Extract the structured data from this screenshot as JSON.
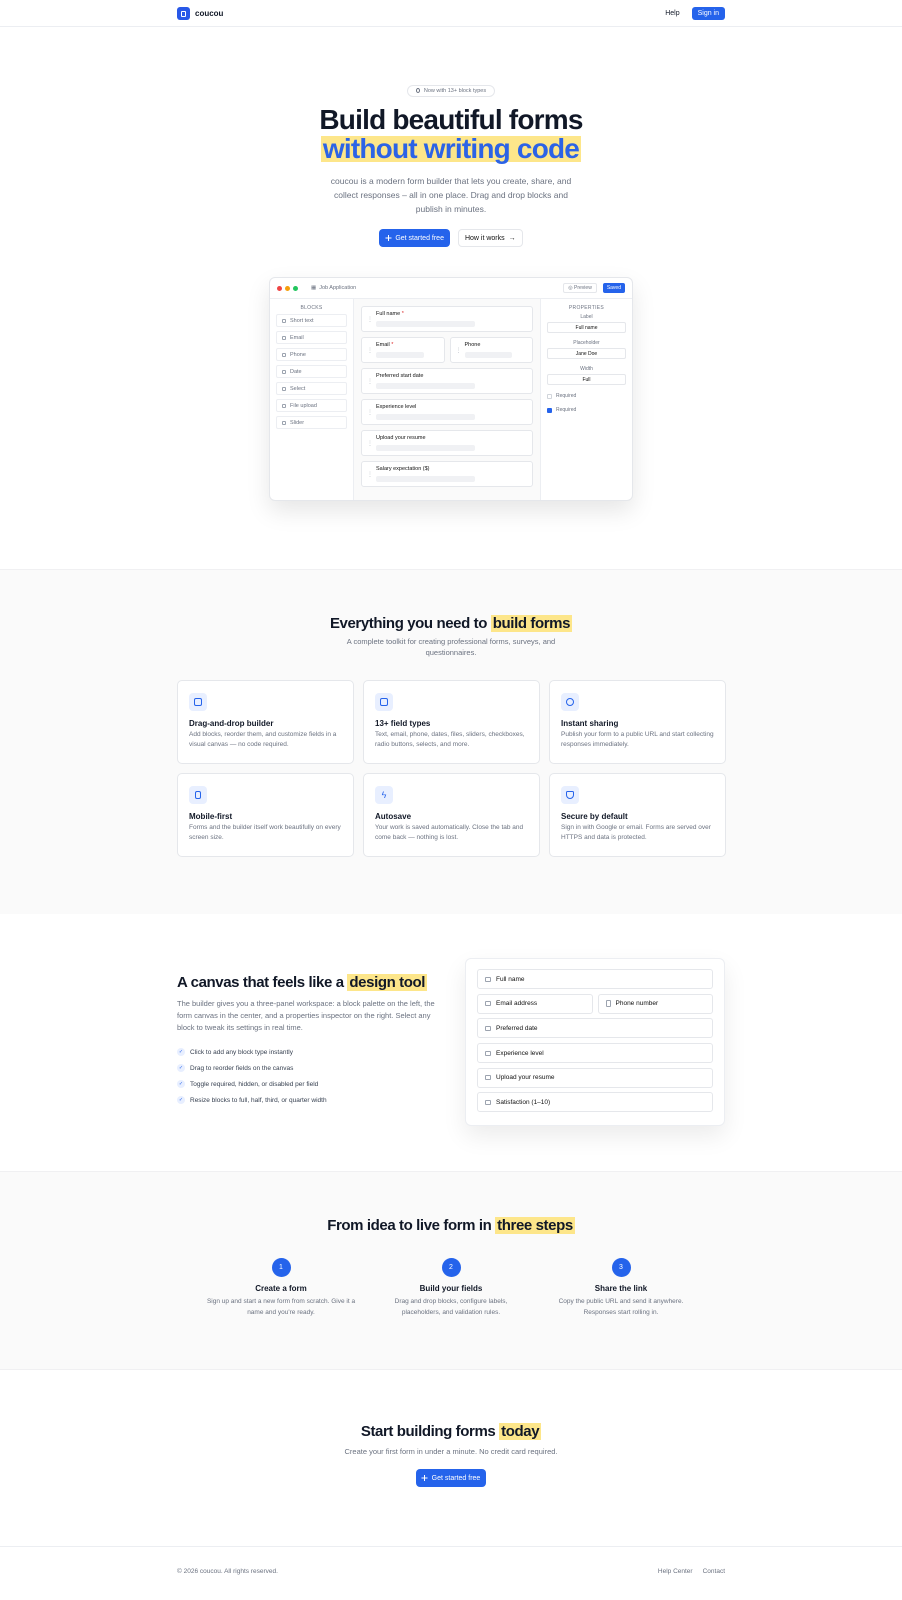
{
  "nav": {
    "brand": "coucou",
    "help": "Help",
    "signin": "Sign in"
  },
  "hero": {
    "badge": "Now with 13+ block types",
    "title_line1": "Build beautiful forms",
    "title_line2": "without writing code",
    "lead": "coucou is a modern form builder that lets you create, share, and collect responses – all in one place. Drag and drop blocks and publish in minutes.",
    "cta_primary": "Get started free",
    "cta_secondary": "How it works"
  },
  "builder": {
    "doc_title": "Job Application",
    "preview": "Preview",
    "saved": "Saved",
    "blocks_title": "BLOCKS",
    "blocks": [
      "Short text",
      "Email",
      "Phone",
      "Date",
      "Select",
      "File upload",
      "Slider"
    ],
    "fields": [
      {
        "label": "Full name",
        "required": "*"
      },
      {
        "label": "Email",
        "required": "*"
      },
      {
        "label": "Phone",
        "required": ""
      },
      {
        "label": "Preferred start date",
        "required": ""
      },
      {
        "label": "Experience level",
        "required": ""
      },
      {
        "label": "Upload your resume",
        "required": ""
      },
      {
        "label": "Salary expectation ($)",
        "required": ""
      }
    ],
    "props": {
      "title": "PROPERTIES",
      "label_label": "Label",
      "label_value": "Full name",
      "placeholder_label": "Placeholder",
      "placeholder_value": "Jane Doe",
      "width_label": "Width",
      "width_value": "Full",
      "check1": "Required",
      "check2": "Required"
    }
  },
  "features": {
    "title_pre": "Everything you need to",
    "title_hl": "build forms",
    "subtitle": "A complete toolkit for creating professional forms, surveys, and questionnaires.",
    "cards": [
      {
        "title": "Drag-and-drop builder",
        "desc": "Add blocks, reorder them, and customize fields in a visual canvas — no code required.",
        "icon": "layout-icon"
      },
      {
        "title": "13+ field types",
        "desc": "Text, email, phone, dates, files, sliders, checkboxes, radio buttons, selects, and more.",
        "icon": "input-icon"
      },
      {
        "title": "Instant sharing",
        "desc": "Publish your form to a public URL and start collecting responses immediately.",
        "icon": "share-icon"
      },
      {
        "title": "Mobile-first",
        "desc": "Forms and the builder itself work beautifully on every screen size.",
        "icon": "phone-icon"
      },
      {
        "title": "Autosave",
        "desc": "Your work is saved automatically. Close the tab and come back — nothing is lost.",
        "icon": "bolt-icon"
      },
      {
        "title": "Secure by default",
        "desc": "Sign in with Google or email. Forms are served over HTTPS and data is protected.",
        "icon": "shield-icon"
      }
    ]
  },
  "canvas": {
    "title_pre": "A canvas that feels like a",
    "title_hl": "design tool",
    "desc": "The builder gives you a three-panel workspace: a block palette on the left, the form canvas in the center, and a properties inspector on the right. Select any block to tweak its settings in real time.",
    "checks": [
      "Click to add any block type instantly",
      "Drag to reorder fields on the canvas",
      "Toggle required, hidden, or disabled per field",
      "Resize blocks to full, half, third, or quarter width"
    ],
    "preview_fields": [
      "Full name",
      "Email address",
      "Phone number",
      "Preferred date",
      "Experience level",
      "Upload your resume",
      "Satisfaction (1–10)"
    ]
  },
  "steps": {
    "title_pre": "From idea to live form in",
    "title_hl": "three steps",
    "items": [
      {
        "num": "1",
        "title": "Create a form",
        "desc": "Sign up and start a new form from scratch. Give it a name and you're ready."
      },
      {
        "num": "2",
        "title": "Build your fields",
        "desc": "Drag and drop blocks, configure labels, placeholders, and validation rules."
      },
      {
        "num": "3",
        "title": "Share the link",
        "desc": "Copy the public URL and send it anywhere. Responses start rolling in."
      }
    ]
  },
  "final": {
    "title_pre": "Start building forms",
    "title_hl": "today",
    "subtitle": "Create your first form in under a minute. No credit card required.",
    "cta": "Get started free"
  },
  "footer": {
    "copyright": "© 2026 coucou. All rights reserved.",
    "help_center": "Help Center",
    "contact": "Contact"
  },
  "colors": {
    "accent": "#2563eb",
    "highlight": "#fde68a",
    "title_blue": "#2c63e6"
  }
}
